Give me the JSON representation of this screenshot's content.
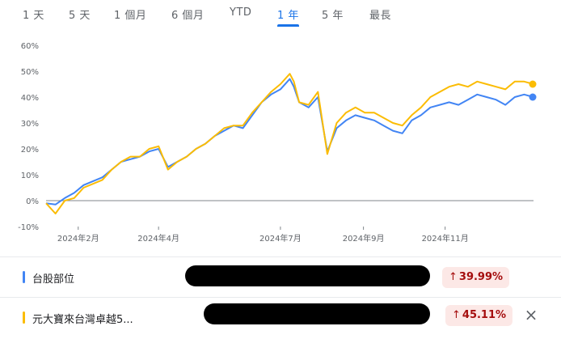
{
  "tabs": [
    {
      "label": "1 天",
      "active": false
    },
    {
      "label": "5 天",
      "active": false
    },
    {
      "label": "1 個月",
      "active": false
    },
    {
      "label": "6 個月",
      "active": false
    },
    {
      "label": "YTD",
      "active": false
    },
    {
      "label": "1 年",
      "active": true
    },
    {
      "label": "5 年",
      "active": false
    },
    {
      "label": "最長",
      "active": false
    }
  ],
  "chart_data": {
    "type": "line",
    "title": "",
    "xlabel": "",
    "ylabel": "",
    "ylim": [
      -10,
      60
    ],
    "y_ticks": [
      "60%",
      "50%",
      "40%",
      "30%",
      "20%",
      "10%",
      "0%",
      "-10%"
    ],
    "x_ticks": [
      "2024年2月",
      "2024年4月",
      "2024年7月",
      "2024年9月",
      "2024年11月"
    ],
    "grid": false,
    "legend": "bottom",
    "x": [
      "2024-01-08",
      "2024-01-15",
      "2024-01-22",
      "2024-01-29",
      "2024-02-05",
      "2024-02-19",
      "2024-02-26",
      "2024-03-04",
      "2024-03-11",
      "2024-03-18",
      "2024-03-25",
      "2024-04-01",
      "2024-04-08",
      "2024-04-15",
      "2024-04-22",
      "2024-04-29",
      "2024-05-06",
      "2024-05-13",
      "2024-05-20",
      "2024-05-27",
      "2024-06-03",
      "2024-06-10",
      "2024-06-17",
      "2024-06-24",
      "2024-07-01",
      "2024-07-08",
      "2024-07-11",
      "2024-07-15",
      "2024-07-22",
      "2024-07-29",
      "2024-08-05",
      "2024-08-12",
      "2024-08-19",
      "2024-08-26",
      "2024-09-02",
      "2024-09-09",
      "2024-09-16",
      "2024-09-23",
      "2024-09-30",
      "2024-10-07",
      "2024-10-14",
      "2024-10-21",
      "2024-10-28",
      "2024-11-04",
      "2024-11-11",
      "2024-11-18",
      "2024-11-25",
      "2024-12-02",
      "2024-12-09",
      "2024-12-16",
      "2024-12-23",
      "2024-12-30",
      "2025-01-06"
    ],
    "series": [
      {
        "name": "台股部位",
        "color": "#4285f4",
        "values": [
          -1,
          -1.5,
          1,
          3,
          6,
          9,
          12,
          15,
          16,
          17,
          19,
          20,
          13,
          15,
          17,
          20,
          22,
          25,
          27,
          29,
          28,
          33,
          38,
          41,
          43,
          47,
          44,
          38,
          36,
          40,
          19,
          28,
          31,
          33,
          32,
          31,
          29,
          27,
          26,
          31,
          33,
          36,
          37,
          38,
          37,
          39,
          41,
          40,
          39,
          37,
          40,
          41,
          40
        ]
      },
      {
        "name": "元大寶來台灣卓越5...",
        "color": "#fbbc04",
        "values": [
          -1,
          -5,
          0,
          1,
          5,
          8,
          12,
          15,
          17,
          17,
          20,
          21,
          12,
          15,
          17,
          20,
          22,
          25,
          28,
          29,
          29,
          34,
          38,
          42,
          45,
          49,
          46,
          38,
          37,
          42,
          18,
          30,
          34,
          36,
          34,
          34,
          32,
          30,
          29,
          33,
          36,
          40,
          42,
          44,
          45,
          44,
          46,
          45,
          44,
          43,
          46,
          46,
          45
        ]
      }
    ]
  },
  "legend_rows": [
    {
      "name": "台股部位",
      "color": "#4285f4",
      "change_arrow": "↑",
      "change": "39.99%"
    },
    {
      "name": "元大寶來台灣卓越5...",
      "color": "#fbbc04",
      "change_arrow": "↑",
      "change": "45.11%"
    }
  ],
  "icons": {
    "close": "×"
  }
}
